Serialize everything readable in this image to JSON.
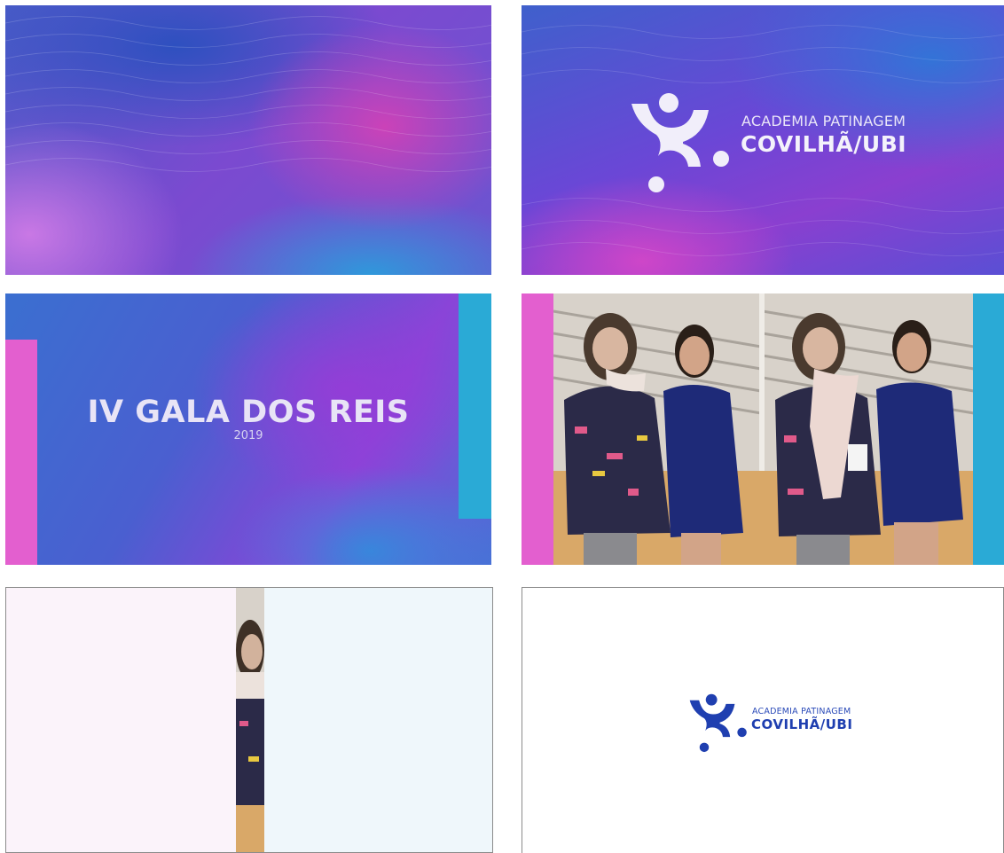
{
  "brand": {
    "line1": "ACADEMIA PATINAGEM",
    "line2": "COVILHÃ/UBI",
    "primary_color": "#1f3fb0",
    "logo_light_color": "#f1eefa"
  },
  "title_card": {
    "title": "IV GALA DOS REIS",
    "year": "2019"
  },
  "accent_colors": {
    "pink": "#e35fcf",
    "cyan": "#2aaad6"
  }
}
